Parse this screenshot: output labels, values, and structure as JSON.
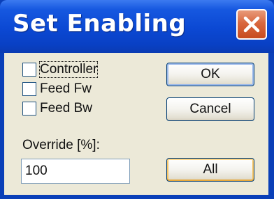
{
  "window": {
    "title": "Set Enabling"
  },
  "icons": {
    "close": "close-icon"
  },
  "colors": {
    "titlebar": "#0b48d3",
    "close_button": "#d9683f",
    "client_bg": "#ece9d8"
  },
  "checkboxes": [
    {
      "label": "Controller",
      "checked": false
    },
    {
      "label": "Feed Fw",
      "checked": false
    },
    {
      "label": "Feed Bw",
      "checked": false
    }
  ],
  "override": {
    "label": "Override [%]:",
    "value": "100"
  },
  "buttons": {
    "ok": "OK",
    "cancel": "Cancel",
    "all": "All"
  }
}
